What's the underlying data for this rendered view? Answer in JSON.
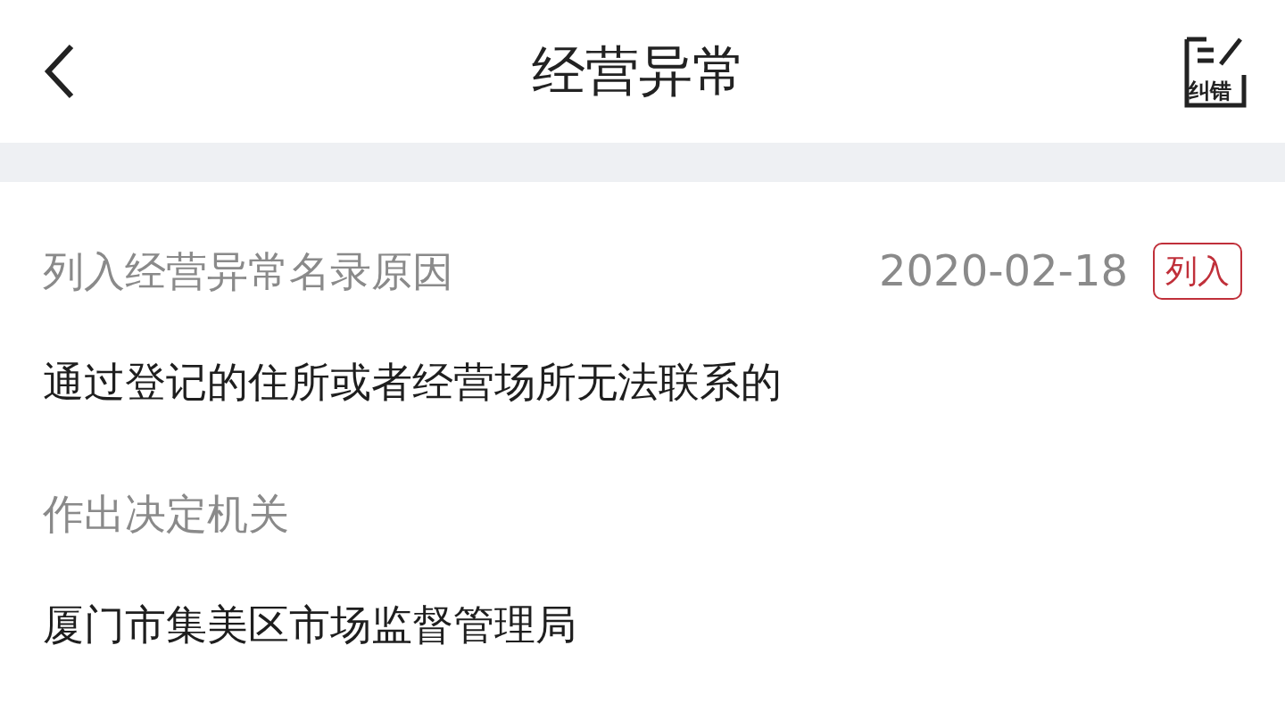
{
  "header": {
    "title": "经营异常",
    "correct_label": "纠错"
  },
  "record": {
    "reason_label": "列入经营异常名录原因",
    "date": "2020-02-18",
    "status_badge": "列入",
    "reason": "通过登记的住所或者经营场所无法联系的",
    "authority_label": "作出决定机关",
    "authority": "厦门市集美区市场监督管理局"
  }
}
